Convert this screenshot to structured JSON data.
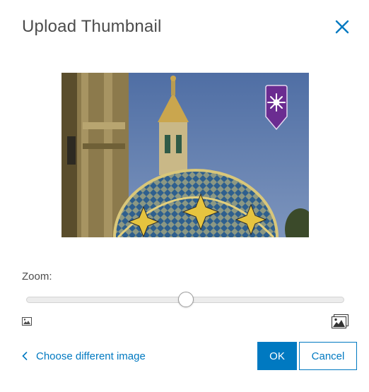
{
  "dialog": {
    "title": "Upload Thumbnail",
    "close_icon": "close-icon"
  },
  "preview": {
    "image_subject": "ornate tiled dome photo",
    "badge_icon": "sparkle-marker-icon"
  },
  "zoom": {
    "label": "Zoom:",
    "level": 0.5,
    "min_icon": "small-image-icon",
    "max_icon": "large-image-icon"
  },
  "footer": {
    "choose_label": "Choose different image",
    "choose_icon": "chevron-left-icon",
    "ok_label": "OK",
    "cancel_label": "Cancel"
  },
  "colors": {
    "accent": "#0079c1",
    "badge": "#6b2c91"
  }
}
